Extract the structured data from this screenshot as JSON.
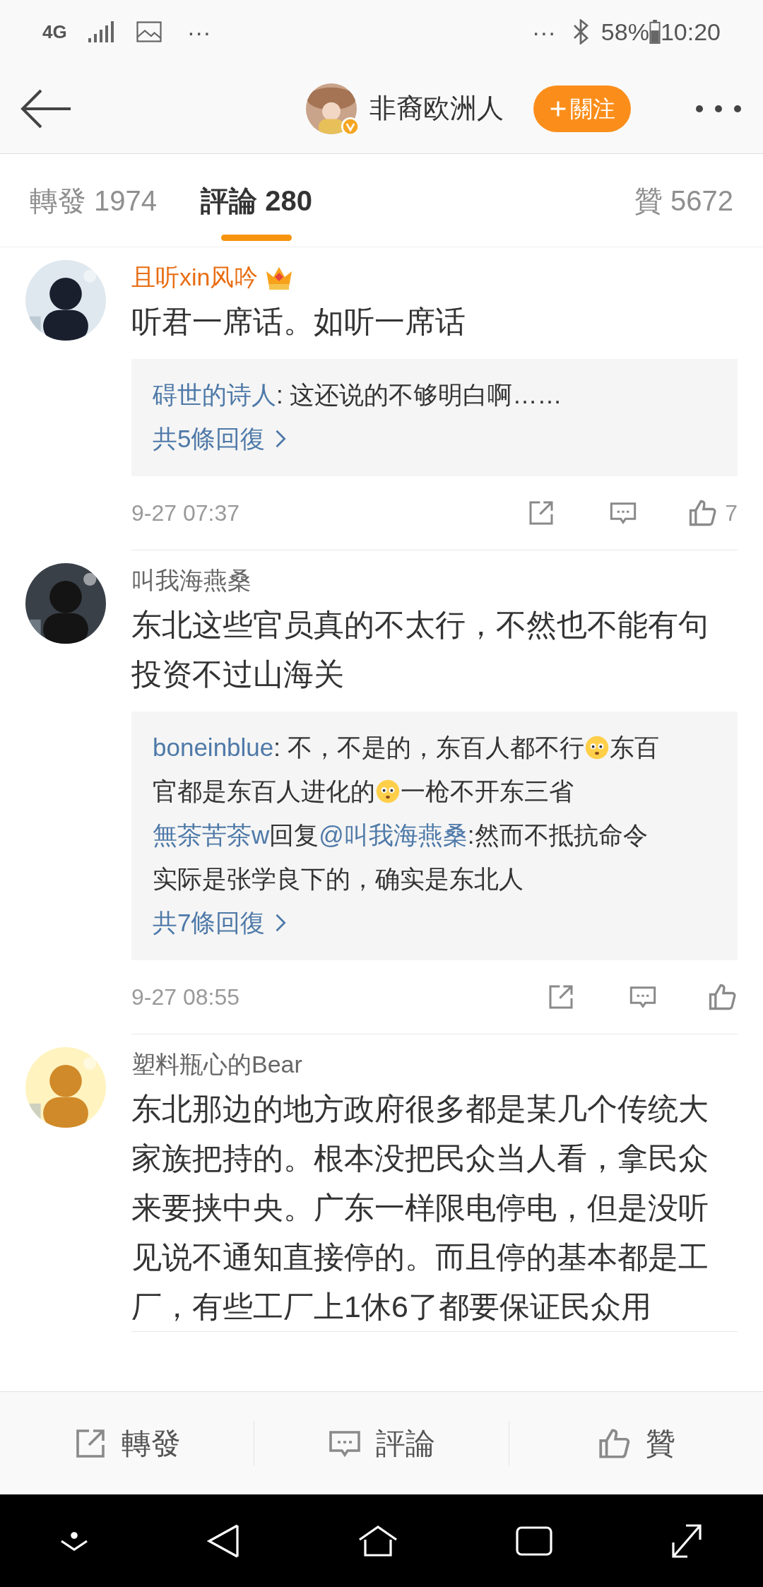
{
  "status_bar": {
    "network": "4G",
    "more_left": "···",
    "more_right": "···",
    "battery": "58%",
    "time": "10:20"
  },
  "header": {
    "title": "非裔欧洲人",
    "verified": true,
    "follow_button": "關注"
  },
  "tabs": [
    {
      "label": "轉發 1974",
      "selected": false
    },
    {
      "label": "評論 280",
      "selected": true
    },
    {
      "label": "贊 5672",
      "selected": false
    }
  ],
  "comments": [
    {
      "author": "且听xin风吟",
      "member": true,
      "text": "听君一席话。如听一席话",
      "replies": [
        [
          [
            {
              "kind": "user",
              "text": "碍世的诗人"
            },
            {
              "kind": "text",
              "text": ": 这还说的不够明白啊……"
            }
          ]
        ]
      ],
      "more_replies": "共5條回復",
      "time": "9-27 07:37",
      "likes": "7"
    },
    {
      "author": "叫我海燕桑",
      "member": false,
      "text": "东北这些官员真的不太行，不然也不能有句投资不过山海关",
      "replies": [
        [
          [
            {
              "kind": "user",
              "text": "boneinblue"
            },
            {
              "kind": "text",
              "text": ": 不，不是的，东百人都不行"
            },
            {
              "kind": "emoji"
            },
            {
              "kind": "text",
              "text": "东百"
            }
          ],
          [
            {
              "kind": "text",
              "text": "官都是东百人进化的"
            },
            {
              "kind": "emoji"
            },
            {
              "kind": "text",
              "text": "一枪不开东三省"
            }
          ]
        ],
        [
          [
            {
              "kind": "user",
              "text": "無茶苦茶w"
            },
            {
              "kind": "text",
              "text": "回复"
            },
            {
              "kind": "user",
              "text": "@叫我海燕桑"
            },
            {
              "kind": "text",
              "text": ":然而不抵抗命令"
            }
          ],
          [
            {
              "kind": "text",
              "text": "实际是张学良下的，确实是东北人"
            }
          ]
        ]
      ],
      "more_replies": "共7條回復",
      "time": "9-27 08:55"
    },
    {
      "author": "塑料瓶心的Bear",
      "member": false,
      "text": "东北那边的地方政府很多都是某几个传统大家族把持的。根本没把民众当人看，拿民众来要挟中央。广东一样限电停电，但是没听见说不通知直接停的。而且停的基本都是工厂，有些工厂上1休6了都要保证民众用"
    }
  ],
  "bottom_bar": [
    {
      "kind": "repost",
      "label": "轉發"
    },
    {
      "kind": "comment",
      "label": "評論"
    },
    {
      "kind": "like",
      "label": "贊"
    }
  ]
}
